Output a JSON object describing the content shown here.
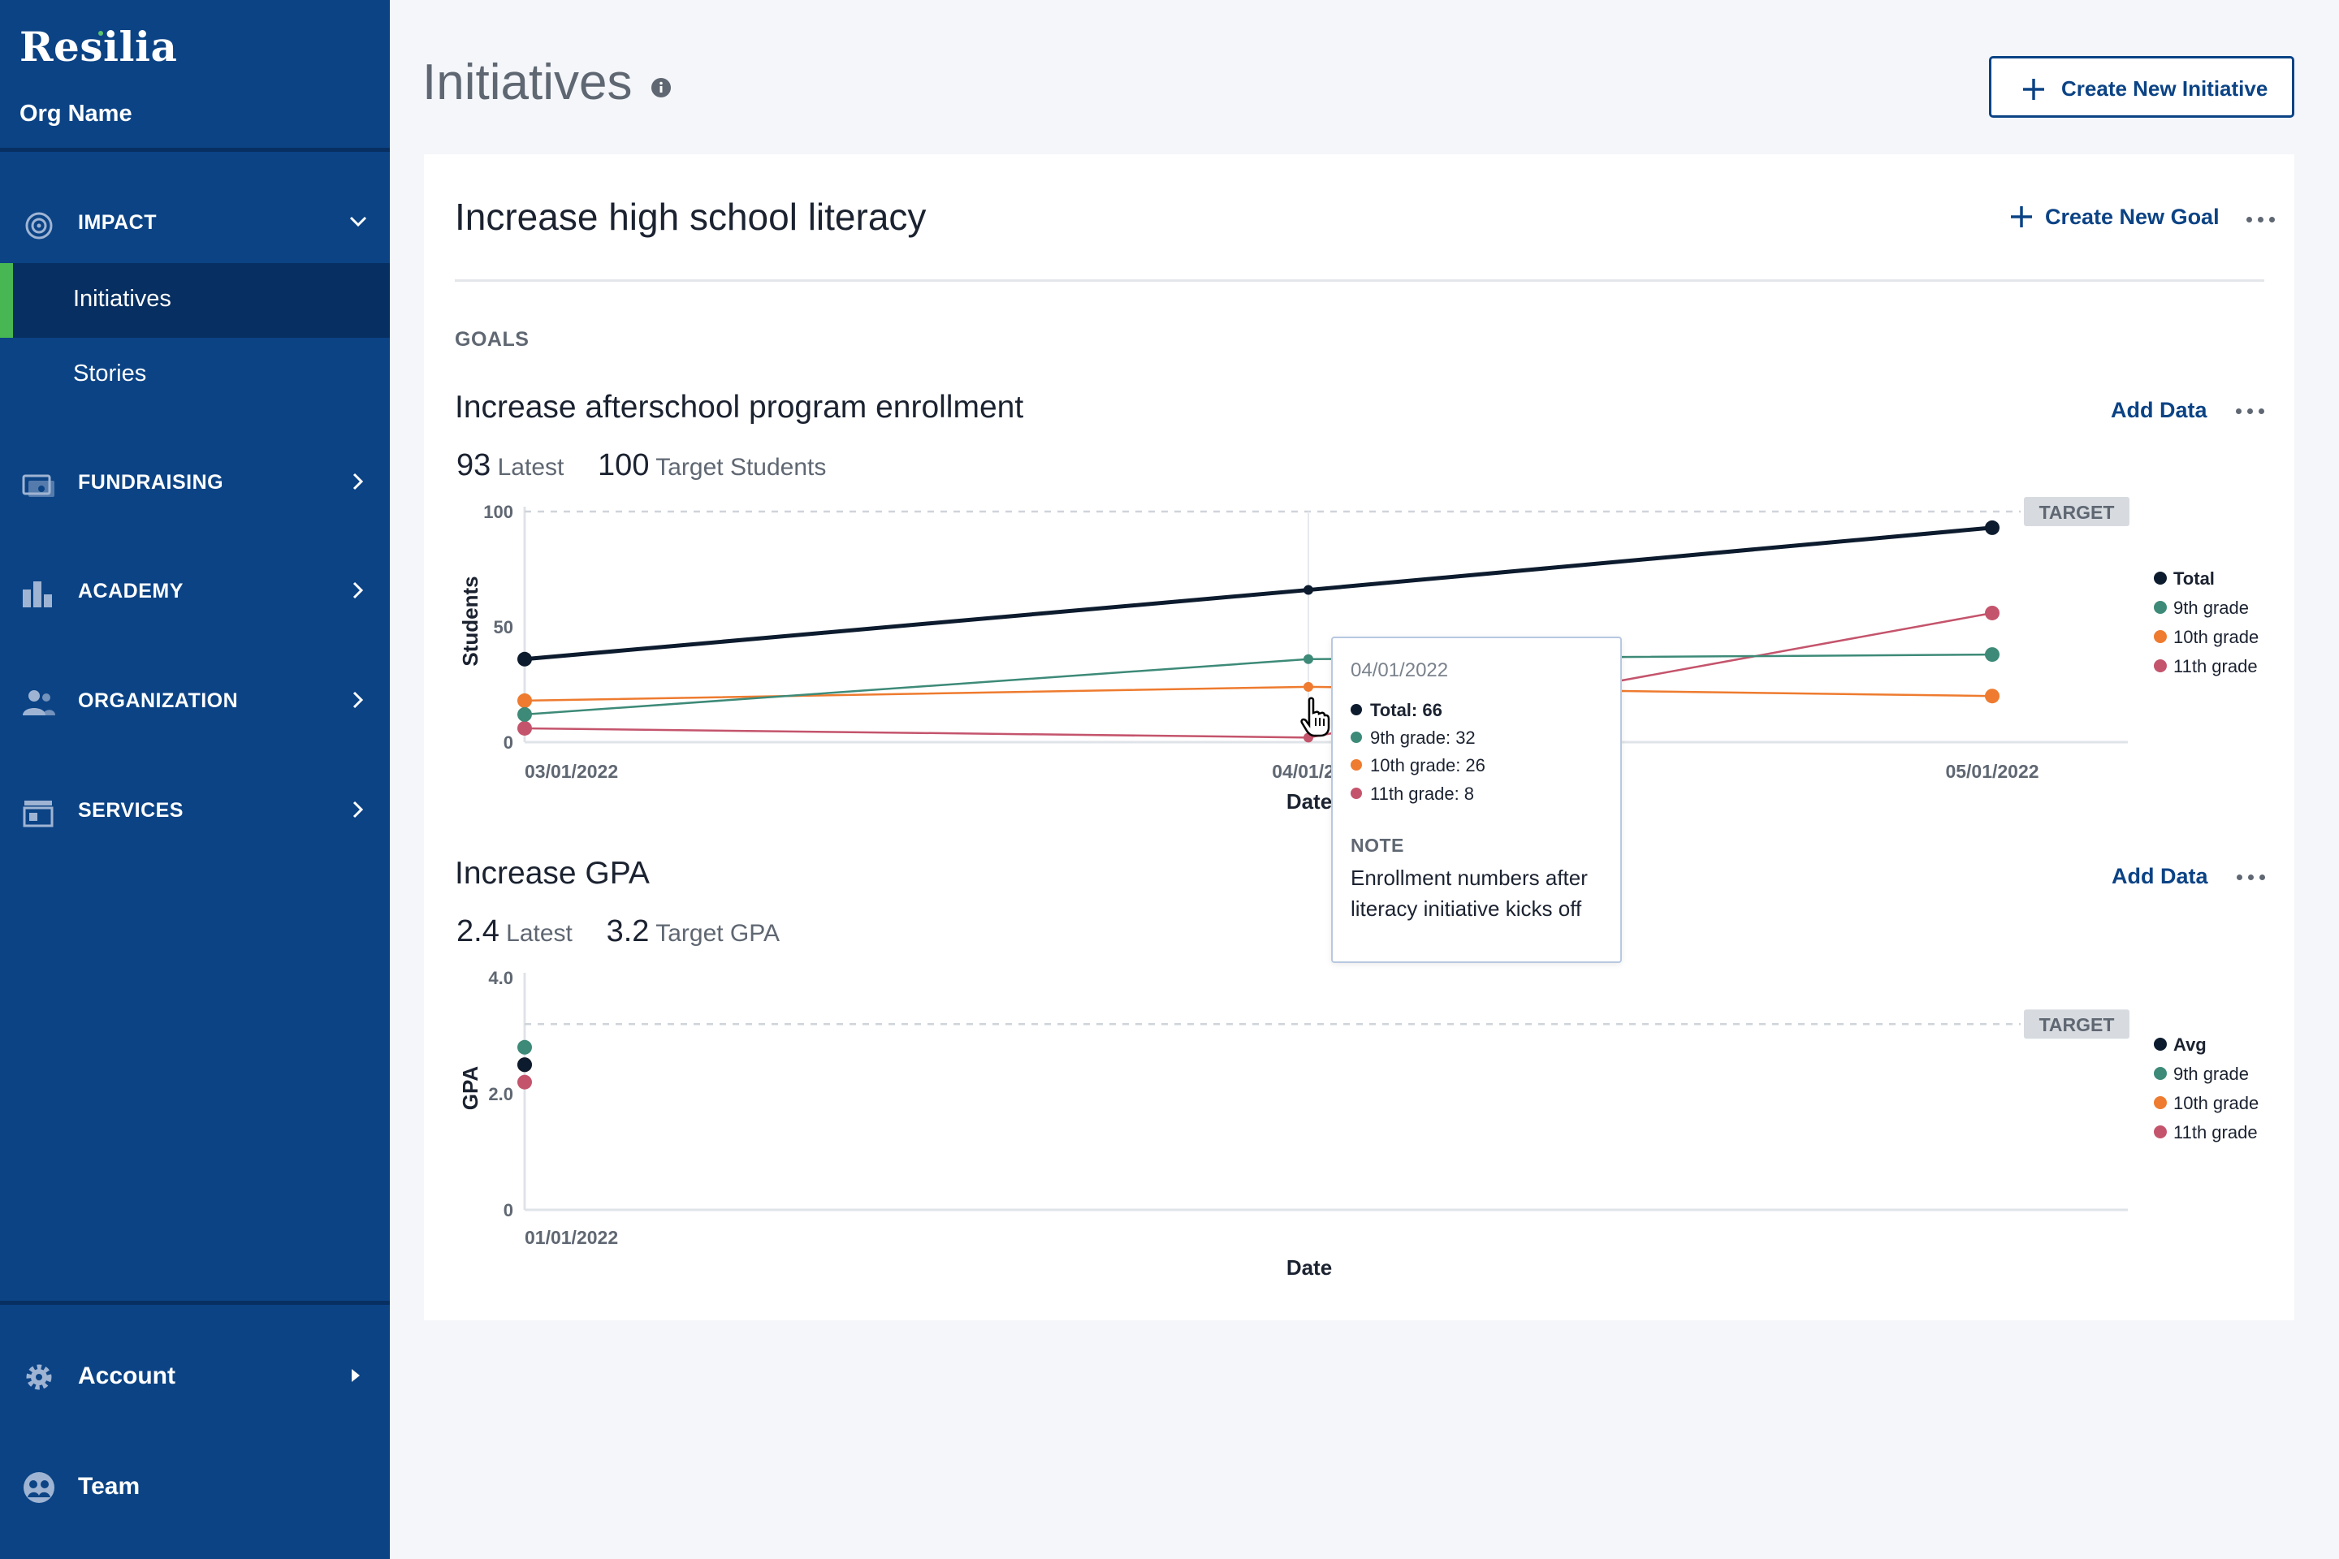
{
  "sidebar": {
    "brand": "Resilia",
    "org_name": "Org Name",
    "sections": [
      {
        "label": "IMPACT",
        "icon": "impact-target-icon",
        "expanded": true
      },
      {
        "label": "FUNDRAISING",
        "icon": "fundraising-icon"
      },
      {
        "label": "ACADEMY",
        "icon": "academy-icon"
      },
      {
        "label": "ORGANIZATION",
        "icon": "organization-people-icon"
      },
      {
        "label": "SERVICES",
        "icon": "services-storefront-icon"
      }
    ],
    "impact_items": [
      {
        "label": "Initiatives",
        "active": true
      },
      {
        "label": "Stories"
      }
    ],
    "account": {
      "label": "Account",
      "icon": "gear-icon"
    },
    "team": {
      "label": "Team",
      "icon": "team-icon"
    }
  },
  "header": {
    "title": "Initiatives",
    "create_button": "Create New Initiative"
  },
  "initiative": {
    "title": "Increase high school literacy",
    "create_goal": "Create New Goal",
    "goals_label": "GOALS"
  },
  "goals": [
    {
      "title": "Increase afterschool program enrollment",
      "add_data": "Add Data",
      "latest_value": "93",
      "latest_label": "Latest",
      "target_value": "100",
      "target_label": "Target Students"
    },
    {
      "title": "Increase GPA",
      "add_data": "Add Data",
      "latest_value": "2.4",
      "latest_label": "Latest",
      "target_value": "3.2",
      "target_label": "Target GPA"
    }
  ],
  "colors": {
    "brand": "#0b4385",
    "accent_green": "#47b653",
    "total": "#0d1b2e",
    "ninth": "#3d8a78",
    "tenth": "#ee7b2f",
    "eleventh": "#c4546c"
  },
  "chart_data": [
    {
      "type": "line",
      "xlabel": "Date",
      "ylabel": "Students",
      "x": [
        "03/01/2022",
        "04/01/2022",
        "05/01/2022"
      ],
      "ylim": [
        0,
        100
      ],
      "yticks": [
        "0",
        "50",
        "100"
      ],
      "target": 100,
      "target_label": "TARGET",
      "legend_position": "right",
      "series": [
        {
          "name": "Total",
          "color": "#0d1b2e",
          "values": [
            36,
            66,
            93
          ]
        },
        {
          "name": "9th grade",
          "color": "#3d8a78",
          "values": [
            12,
            36,
            38
          ]
        },
        {
          "name": "10th grade",
          "color": "#ee7b2f",
          "values": [
            18,
            24,
            20
          ]
        },
        {
          "name": "11th grade",
          "color": "#c4546c",
          "values": [
            6,
            2,
            56
          ]
        }
      ],
      "x_tick_labels": [
        "03/01/2022",
        "04/01/20",
        "05/01/2022"
      ],
      "tooltip": {
        "date": "04/01/2022",
        "rows": [
          {
            "label": "Total: 66",
            "color": "#0d1b2e",
            "bold": true
          },
          {
            "label": "9th grade: 32",
            "color": "#3d8a78"
          },
          {
            "label": "10th grade: 26",
            "color": "#ee7b2f"
          },
          {
            "label": "11th grade: 8",
            "color": "#c4546c"
          }
        ],
        "note_heading": "NOTE",
        "note": "Enrollment numbers after literacy initiative kicks off"
      }
    },
    {
      "type": "scatter",
      "xlabel": "Date",
      "ylabel": "GPA",
      "x": [
        "01/01/2022"
      ],
      "ylim": [
        0,
        4
      ],
      "yticks": [
        "0",
        "2.0",
        "4.0"
      ],
      "target": 3.2,
      "target_label": "TARGET",
      "legend_position": "right",
      "series": [
        {
          "name": "Avg",
          "color": "#0d1b2e",
          "values": [
            2.5
          ]
        },
        {
          "name": "9th grade",
          "color": "#3d8a78",
          "values": [
            2.8
          ]
        },
        {
          "name": "10th grade",
          "color": "#ee7b2f",
          "values": [
            2.5
          ]
        },
        {
          "name": "11th grade",
          "color": "#c4546c",
          "values": [
            2.2
          ]
        }
      ]
    }
  ]
}
